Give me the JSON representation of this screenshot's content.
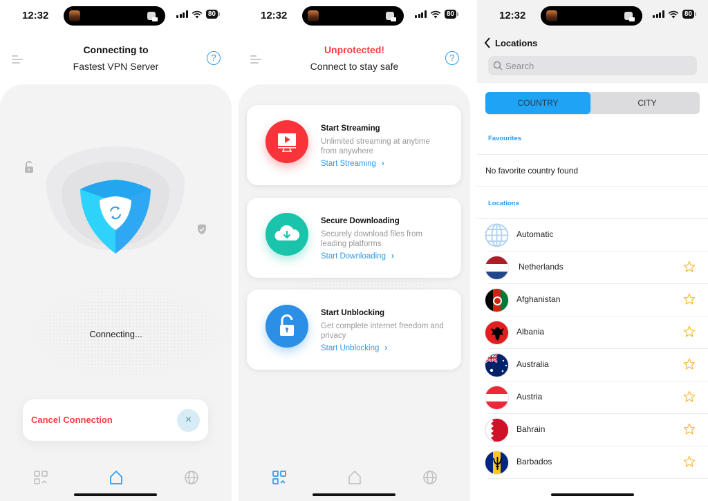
{
  "status_bar": {
    "time": "12:32",
    "battery": "80"
  },
  "connecting_screen": {
    "title": "Connecting to",
    "subtitle": "Fastest VPN Server",
    "status": "Connecting...",
    "cancel_label": "Cancel Connection",
    "cancel_icon": "×",
    "help_icon": "?",
    "active_tab": "home"
  },
  "home_screen": {
    "title": "Unprotected!",
    "subtitle": "Connect to stay safe",
    "help_icon": "?",
    "active_tab": "features",
    "cards": [
      {
        "title": "Start Streaming",
        "description": "Unlimited streaming at anytime from anywhere",
        "link": "Start Streaming",
        "icon": "tv-play-icon",
        "color": "#f8333a"
      },
      {
        "title": "Secure Downloading",
        "description": "Securely download files from leading platforms",
        "link": "Start Downloading",
        "icon": "cloud-download-icon",
        "color": "#19c4aa"
      },
      {
        "title": "Start Unblocking",
        "description": "Get complete internet freedom and privacy",
        "link": "Start Unblocking",
        "icon": "unlock-icon",
        "color": "#2b8fe6"
      }
    ]
  },
  "locations_screen": {
    "back_label": "Locations",
    "search_placeholder": "Search",
    "segments": {
      "active": "COUNTRY",
      "inactive": "CITY"
    },
    "favourites_label": "Favourites",
    "no_favourites": "No favorite country found",
    "locations_label": "Locations",
    "rows": [
      {
        "name": "Automatic",
        "flag": "globe",
        "favoritable": false
      },
      {
        "name": "Netherlands",
        "flag": "nl",
        "favoritable": true
      },
      {
        "name": "Afghanistan",
        "flag": "af",
        "favoritable": true
      },
      {
        "name": "Albania",
        "flag": "al",
        "favoritable": true
      },
      {
        "name": "Australia",
        "flag": "au",
        "favoritable": true
      },
      {
        "name": "Austria",
        "flag": "at",
        "favoritable": true
      },
      {
        "name": "Bahrain",
        "flag": "bh",
        "favoritable": true
      },
      {
        "name": "Barbados",
        "flag": "bb",
        "favoritable": true
      }
    ]
  },
  "colors": {
    "accent": "#2f9bea",
    "danger": "#ff3b3b",
    "star": "#f5b82e",
    "segment_active": "#1fa3f5"
  }
}
